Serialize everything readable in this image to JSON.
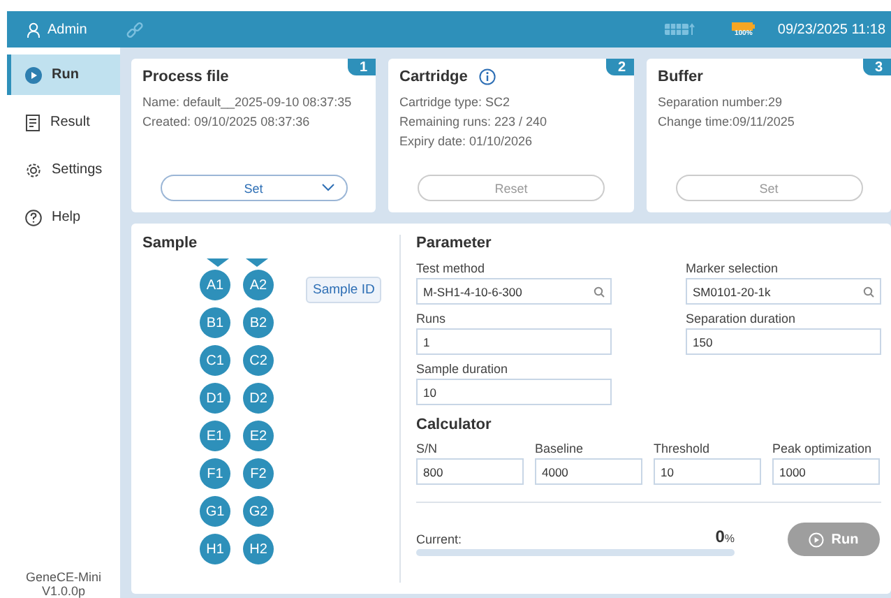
{
  "header": {
    "user": "Admin",
    "battery_label": "100%",
    "datetime": "09/23/2025 11:18"
  },
  "sidebar": {
    "items": [
      {
        "label": "Run",
        "selected": true
      },
      {
        "label": "Result",
        "selected": false
      },
      {
        "label": "Settings",
        "selected": false
      },
      {
        "label": "Help",
        "selected": false
      }
    ],
    "version": "GeneCE-Mini\nV1.0.0p"
  },
  "cards": [
    {
      "title": "Process file",
      "badge": "1",
      "info": false,
      "lines": [
        "Name: default__2025-09-10 08:37:35",
        "Created: 09/10/2025 08:37:36"
      ],
      "button": {
        "label": "Set",
        "dropdown": true,
        "disabled": false
      }
    },
    {
      "title": "Cartridge",
      "badge": "2",
      "info": true,
      "lines": [
        "Cartridge type: SC2",
        "Remaining runs: 223 / 240",
        "Expiry date: 01/10/2026"
      ],
      "button": {
        "label": "Reset",
        "dropdown": false,
        "disabled": true
      }
    },
    {
      "title": "Buffer",
      "badge": "3",
      "info": false,
      "lines": [
        "Separation number:29",
        "Change time:09/11/2025"
      ],
      "button": {
        "label": "Set",
        "dropdown": false,
        "disabled": true
      }
    }
  ],
  "sample": {
    "title": "Sample",
    "sample_id_button": "Sample ID",
    "rows": [
      [
        "A1",
        "A2"
      ],
      [
        "B1",
        "B2"
      ],
      [
        "C1",
        "C2"
      ],
      [
        "D1",
        "D2"
      ],
      [
        "E1",
        "E2"
      ],
      [
        "F1",
        "F2"
      ],
      [
        "G1",
        "G2"
      ],
      [
        "H1",
        "H2"
      ]
    ]
  },
  "parameter": {
    "title": "Parameter",
    "fields": [
      {
        "label": "Test method",
        "value": "M-SH1-4-10-6-300",
        "kind": "search"
      },
      {
        "label": "Marker selection",
        "value": "SM0101-20-1k",
        "kind": "search"
      },
      {
        "label": "Runs",
        "value": "1",
        "kind": "text"
      },
      {
        "label": "Separation duration",
        "value": "150",
        "kind": "text"
      },
      {
        "label": "Sample duration",
        "value": "10",
        "kind": "text"
      }
    ]
  },
  "calculator": {
    "title": "Calculator",
    "fields": [
      {
        "label": "S/N",
        "value": "800"
      },
      {
        "label": "Baseline",
        "value": "4000"
      },
      {
        "label": "Threshold",
        "value": "10"
      },
      {
        "label": "Peak optimization",
        "value": "1000"
      }
    ]
  },
  "progress": {
    "label": "Current:",
    "percent": "0",
    "unit": "%",
    "level": 0
  },
  "run_button": {
    "label": "Run",
    "disabled": true
  }
}
